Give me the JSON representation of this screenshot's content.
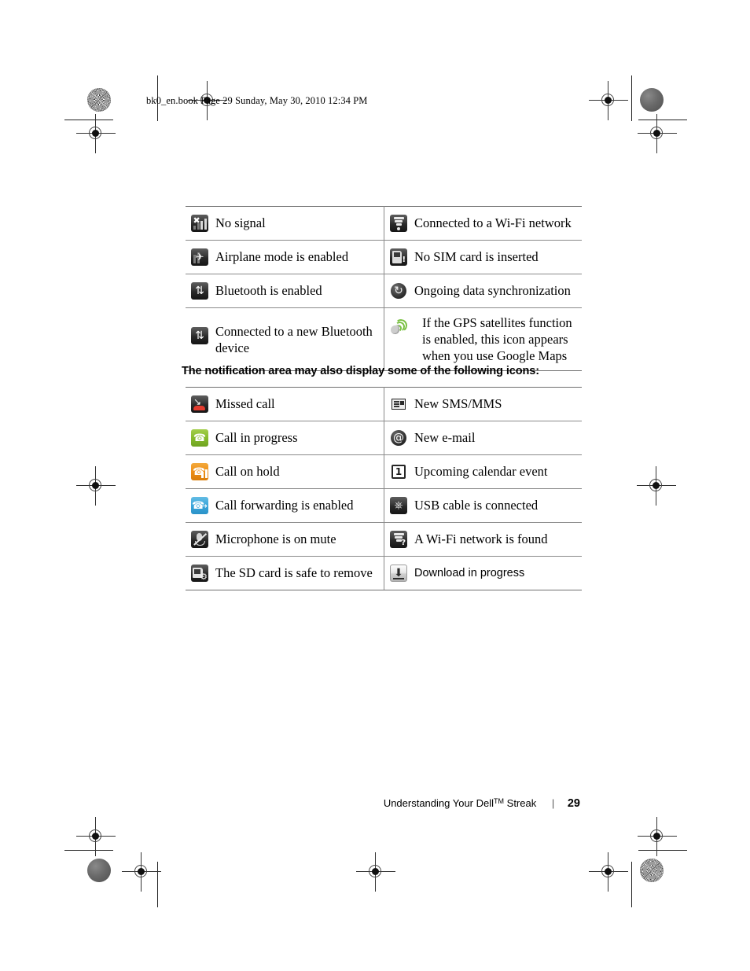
{
  "page": {
    "book_header": "bk0_en.book  Page 29  Sunday, May 30, 2010  12:34 PM",
    "section_heading": "The notification area may also display some of the following icons:",
    "footer_title": "Understanding Your Dell",
    "footer_tm": "TM",
    "footer_title_rest": " Streak",
    "footer_separator": "|",
    "page_number": "29"
  },
  "colors": {
    "green": "#86bb2c",
    "orange": "#ee8f16",
    "blue": "#3aa6db",
    "red": "#e23b2e",
    "gps_green": "#7ac143",
    "rule": "#8a8a8a"
  },
  "status_table": {
    "rows": [
      {
        "left": {
          "icon": "no-signal-icon",
          "label": "No signal"
        },
        "right": {
          "icon": "wifi-connected-icon",
          "label": "Connected to a Wi-Fi network"
        }
      },
      {
        "left": {
          "icon": "airplane-mode-icon",
          "label": "Airplane mode is enabled"
        },
        "right": {
          "icon": "no-sim-card-icon",
          "label": "No SIM card is inserted"
        }
      },
      {
        "left": {
          "icon": "bluetooth-icon",
          "label": "Bluetooth is enabled"
        },
        "right": {
          "icon": "data-sync-icon",
          "label": "Ongoing data synchronization"
        }
      },
      {
        "left": {
          "icon": "bluetooth-connected-icon",
          "label": "Connected to a new Bluetooth device"
        },
        "right": {
          "icon": "gps-icon",
          "label": "If the GPS satellites function is enabled, this icon appears when you use Google Maps"
        }
      }
    ]
  },
  "notification_table": {
    "rows": [
      {
        "left": {
          "icon": "missed-call-icon",
          "label": "Missed call"
        },
        "right": {
          "icon": "new-sms-mms-icon",
          "label": "New SMS/MMS"
        }
      },
      {
        "left": {
          "icon": "call-in-progress-icon",
          "label": "Call in progress"
        },
        "right": {
          "icon": "new-email-icon",
          "label": "New e-mail"
        }
      },
      {
        "left": {
          "icon": "call-on-hold-icon",
          "label": "Call on hold"
        },
        "right": {
          "icon": "calendar-event-icon",
          "label": "Upcoming calendar event"
        }
      },
      {
        "left": {
          "icon": "call-forwarding-icon",
          "label": "Call forwarding is enabled"
        },
        "right": {
          "icon": "usb-connected-icon",
          "label": "USB cable is connected"
        }
      },
      {
        "left": {
          "icon": "microphone-mute-icon",
          "label": "Microphone is on mute"
        },
        "right": {
          "icon": "wifi-found-icon",
          "label": "A Wi-Fi network is found"
        }
      },
      {
        "left": {
          "icon": "sd-card-safe-icon",
          "label": "The SD card is safe to remove"
        },
        "right": {
          "icon": "download-progress-icon",
          "label": "Download in progress"
        }
      }
    ]
  }
}
